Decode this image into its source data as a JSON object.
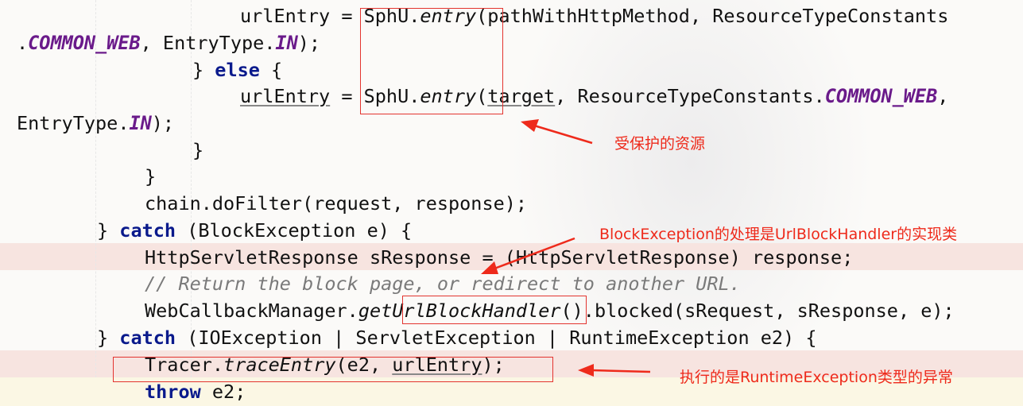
{
  "code": {
    "line1_a": "urlEntry = SphU.",
    "line1_method": "entry",
    "line1_b": "(pathWithHttpMethod, ResourceTypeConstants",
    "line2_a": ".",
    "line2_const1": "COMMON_WEB",
    "line2_b": ", EntryType.",
    "line2_const2": "IN",
    "line2_c": ");",
    "line3_a": "} ",
    "line3_kw": "else",
    "line3_b": " {",
    "line4_var": "urlEntry",
    "line4_a": " = SphU.",
    "line4_method": "entry",
    "line4_b": "(",
    "line4_target": "target",
    "line4_c": ", ResourceTypeConstants.",
    "line4_const": "COMMON_WEB",
    "line4_d": ",",
    "line5_a": "EntryType.",
    "line5_const": "IN",
    "line5_b": ");",
    "line6": "}",
    "line7": "}",
    "line8": "chain.doFilter(request, response);",
    "line9_a": "} ",
    "line9_kw": "catch",
    "line9_b": " (BlockException e) {",
    "line10": "HttpServletResponse sResponse = (HttpServletResponse) response;",
    "line11": "// Return the block page, or redirect to another URL.",
    "line12_a": "WebCallbackManager.",
    "line12_method": "getUrlBlockHandler",
    "line12_b": "().blocked(sRequest, sResponse, e);",
    "line13_a": "} ",
    "line13_kw": "catch",
    "line13_b": " (IOException | ServletException | RuntimeException e2) {",
    "line14_a": "Tracer.",
    "line14_method": "traceEntry",
    "line14_b": "(e2, ",
    "line14_var": "urlEntry",
    "line14_c": ");",
    "line15_kw": "throw",
    "line15_b": " e2;"
  },
  "annotations": {
    "protected_resource": "受保护的资源",
    "block_exception": "BlockException的处理是UrlBlockHandler的实现类",
    "runtime_exception": "执行的是RuntimeException类型的异常"
  },
  "colors": {
    "annotation_red": "#ee2a1b",
    "keyword_blue": "#0a1a8c",
    "constant_purple": "#6a1a8a",
    "highlight_row": "#f7e4e0"
  }
}
